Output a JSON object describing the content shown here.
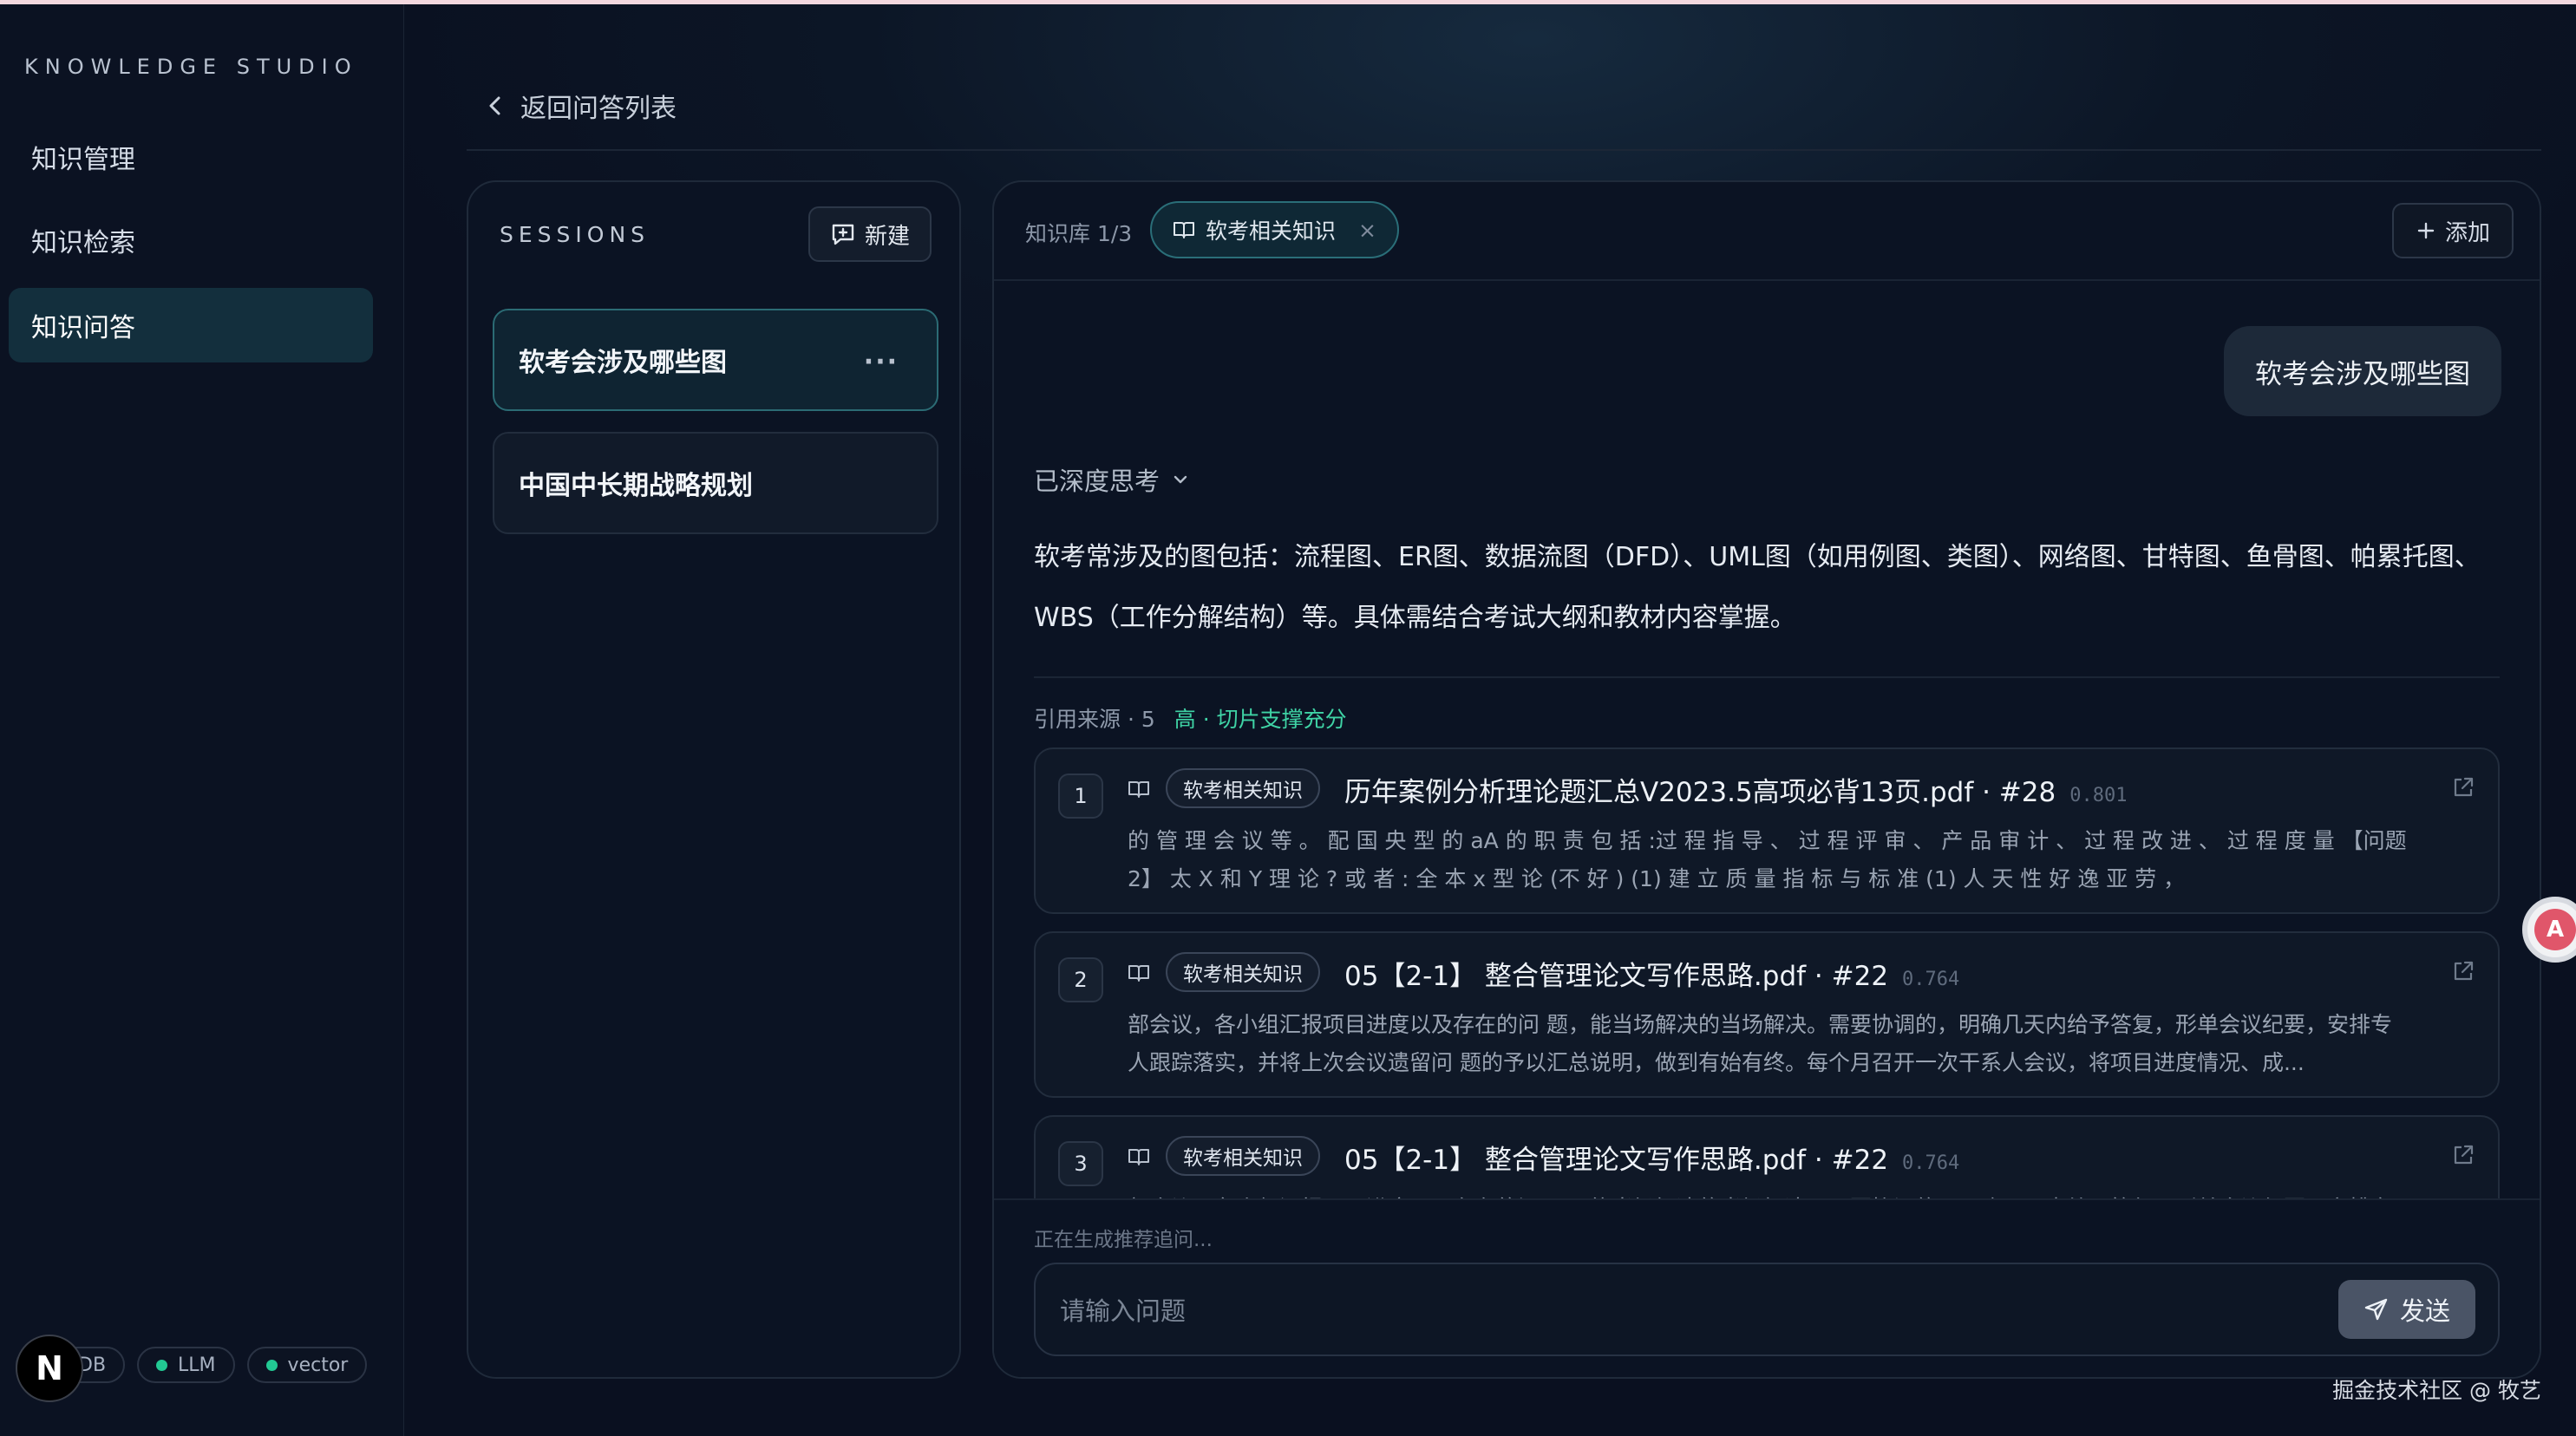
{
  "sidebar": {
    "brand": "KNOWLEDGE STUDIO",
    "nav": [
      {
        "label": "知识管理",
        "active": false
      },
      {
        "label": "知识检索",
        "active": false
      },
      {
        "label": "知识问答",
        "active": true
      }
    ],
    "status": [
      {
        "label": "DB",
        "color": "#22c993"
      },
      {
        "label": "LLM",
        "color": "#22c993"
      },
      {
        "label": "vector",
        "color": "#22c993"
      }
    ],
    "logo_letter": "N"
  },
  "back_label": "返回问答列表",
  "sessions": {
    "title": "SESSIONS",
    "new_label": "新建",
    "more_label": "···",
    "items": [
      {
        "label": "软考会涉及哪些图",
        "active": true
      },
      {
        "label": "中国中长期战略规划",
        "active": false
      }
    ]
  },
  "chat": {
    "kb_count": "知识库 1/3",
    "kb_chip": "软考相关知识",
    "kb_chip_remove": "×",
    "add_label": "添加",
    "user_message": "软考会涉及哪些图",
    "thinking_label": "已深度思考",
    "answer": "软考常涉及的图包括：流程图、ER图、数据流图（DFD）、UML图（如用例图、类图）、网络图、甘特图、鱼骨图、帕累托图、WBS（工作分解结构）等。具体需结合考试大纲和教材内容掌握。",
    "citations_label": "引用来源 · 5",
    "citations_quality": "高 · 切片支撑充分",
    "citations": [
      {
        "num": "1",
        "tag": "软考相关知识",
        "title": "历年案例分析理论题汇总V2023.5高项必背13页.pdf · #28",
        "score": "0.801",
        "snippet": "的 管 理 会 议 等 。 配 国 央 型 的 aA 的 职 责 包 括 :过 程 指 导 、 过 程 评 审 、 产 品 审 计 、 过 程 改 进 、 过 程 度 量 【问题 2】 太 X 和 Y 理 论 ? 或 者 : 全 本 x 型 论 (不 好 ) (1) 建 立 质 量 指 标 与 标 准 (1) 人 天 性 好 逸 亚 劳 ，"
      },
      {
        "num": "2",
        "tag": "软考相关知识",
        "title": "05【2-1】 整合管理论文写作思路.pdf · #22",
        "score": "0.764",
        "snippet": "部会议，各小组汇报项目进度以及存在的问 题，能当场解决的当场解决。需要协调的，明确几天内给予答复，形单会议纪要，安排专人跟踪落实，并将上次会议遗留问 题的予以汇总说明，做到有始有终。每个月召开一次干系人会议，将项目进度情况、成..."
      },
      {
        "num": "3",
        "tag": "软考相关知识",
        "title": "05【2-1】 整合管理论文写作思路.pdf · #22",
        "score": "0.764",
        "snippet": "部会议，各小组汇报项目进度以及存在的问 题，能当场解决的当场解决。需要协调的，明确几天内给予答复，形单会议纪要，安排专人跟踪落实，并将上次会议遗留问 题的予以汇总说明，做到有始有终。"
      }
    ],
    "suggest_status": "正在生成推荐追问...",
    "input_placeholder": "请输入问题",
    "input_value": "",
    "send_label": "发送"
  },
  "watermark": "掘金技术社区 @ 牧艺",
  "float_button_glyph": "A"
}
